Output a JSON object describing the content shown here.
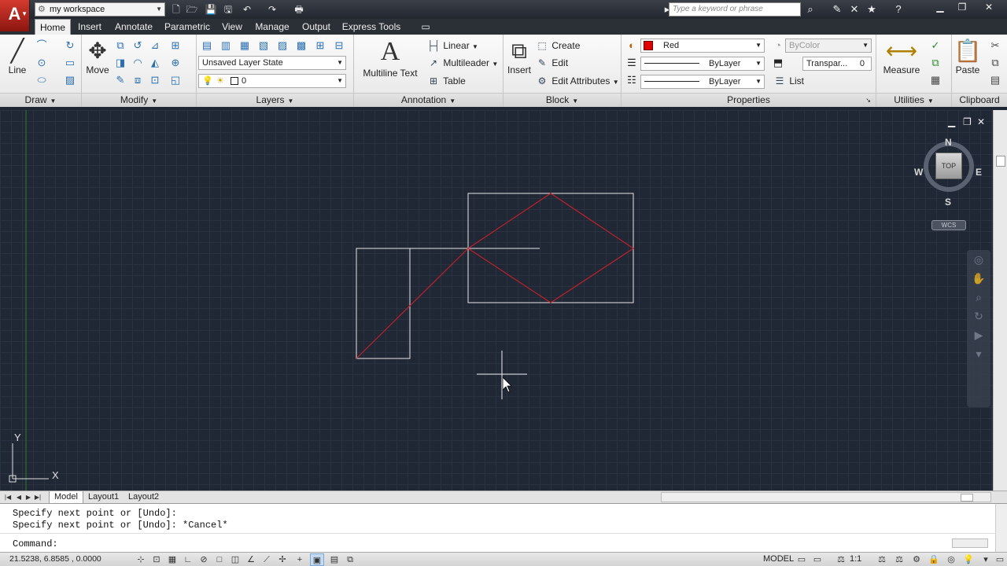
{
  "titlebar": {
    "app_logo": "A",
    "workspace": "my workspace",
    "search_placeholder": "Type a keyword or phrase"
  },
  "tabs": [
    "Home",
    "Insert",
    "Annotate",
    "Parametric",
    "View",
    "Manage",
    "Output",
    "Express Tools"
  ],
  "ribbon": {
    "draw": {
      "title": "Draw",
      "line_label": "Line"
    },
    "modify": {
      "title": "Modify",
      "move_label": "Move"
    },
    "layers": {
      "title": "Layers",
      "layer_state": "Unsaved Layer State",
      "current_layer": "0"
    },
    "annotation": {
      "title": "Annotation",
      "multiline_text": "Multiline Text",
      "linear": "Linear",
      "multileader": "Multileader",
      "table": "Table"
    },
    "block": {
      "title": "Block",
      "insert": "Insert",
      "create": "Create",
      "edit": "Edit",
      "edit_attributes": "Edit Attributes"
    },
    "properties": {
      "title": "Properties",
      "color": "Red",
      "color_hex": "#e00000",
      "linetype": "ByLayer",
      "lineweight": "ByLayer",
      "plotstyle": "ByColor",
      "transparency_label": "Transpar...",
      "transparency_value": "0",
      "list": "List"
    },
    "utilities": {
      "title": "Utilities",
      "measure": "Measure"
    },
    "clipboard": {
      "title": "Clipboard",
      "paste": "Paste"
    }
  },
  "viewcube": {
    "top": "TOP",
    "north": "N",
    "south": "S",
    "east": "E",
    "west": "W",
    "wcs": "WCS"
  },
  "ucs": {
    "y": "Y",
    "x": "X"
  },
  "layout_tabs": [
    "Model",
    "Layout1",
    "Layout2"
  ],
  "command": {
    "history": [
      "Specify next point or [Undo]:",
      "Specify next point or [Undo]: *Cancel*"
    ],
    "prompt": "Command:"
  },
  "status": {
    "coordinates": "21.5238, 6.8585 , 0.0000",
    "model": "MODEL",
    "scale": "1:1"
  },
  "colors": {
    "accent_red": "#c0202a",
    "canvas_bg": "#212835"
  }
}
